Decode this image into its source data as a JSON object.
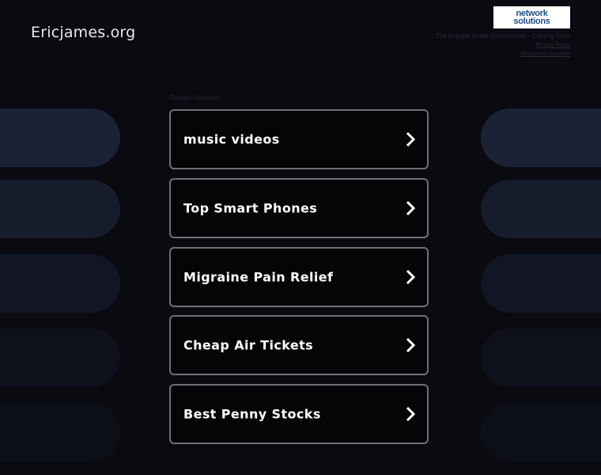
{
  "header": {
    "site_title": "Ericjames.org",
    "logo_line1": "network",
    "logo_line2": "solutions",
    "tagline": "The Experts Under Construction - Coming Soon",
    "link1": "Privacy Policy",
    "link2": "Resources Example"
  },
  "related_label": "Related Searches",
  "links": [
    {
      "label": "music videos"
    },
    {
      "label": "Top Smart Phones"
    },
    {
      "label": "Migraine Pain Relief"
    },
    {
      "label": "Cheap Air Tickets"
    },
    {
      "label": "Best Penny Stocks"
    }
  ],
  "colors": {
    "background": "#0a0a10",
    "link_border": "#6f6f78",
    "pill_dark_blue": "#1c2236",
    "logo_text": "#1d4f8a"
  },
  "icons": {
    "chevron": "chevron-right-icon"
  }
}
